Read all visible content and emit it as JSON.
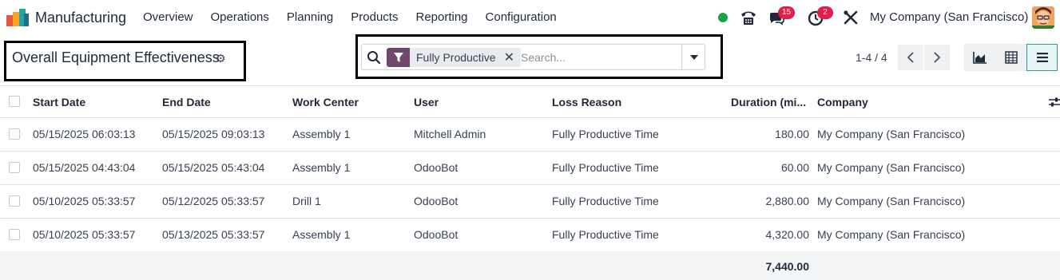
{
  "navbar": {
    "app_name": "Manufacturing",
    "menu": [
      "Overview",
      "Operations",
      "Planning",
      "Products",
      "Reporting",
      "Configuration"
    ],
    "messages_count": "15",
    "activities_count": "2",
    "company": "My Company (San Francisco)"
  },
  "control_panel": {
    "title": "Overall Equipment Effectiveness",
    "search": {
      "facet_label": "Fully Productive",
      "placeholder": "Search..."
    },
    "pager": "1-4 / 4"
  },
  "table": {
    "headers": {
      "start_date": "Start Date",
      "end_date": "End Date",
      "work_center": "Work Center",
      "user": "User",
      "loss_reason": "Loss Reason",
      "duration": "Duration (mi...",
      "company": "Company"
    },
    "rows": [
      {
        "start_date": "05/15/2025 06:03:13",
        "end_date": "05/15/2025 09:03:13",
        "work_center": "Assembly 1",
        "user": "Mitchell Admin",
        "loss_reason": "Fully Productive Time",
        "duration": "180.00",
        "company": "My Company (San Francisco)"
      },
      {
        "start_date": "05/15/2025 04:43:04",
        "end_date": "05/15/2025 05:43:04",
        "work_center": "Assembly 1",
        "user": "OdooBot",
        "loss_reason": "Fully Productive Time",
        "duration": "60.00",
        "company": "My Company (San Francisco)"
      },
      {
        "start_date": "05/10/2025 05:33:57",
        "end_date": "05/12/2025 05:33:57",
        "work_center": "Drill 1",
        "user": "OdooBot",
        "loss_reason": "Fully Productive Time",
        "duration": "2,880.00",
        "company": "My Company (San Francisco)"
      },
      {
        "start_date": "05/10/2025 05:33:57",
        "end_date": "05/13/2025 05:33:57",
        "work_center": "Assembly 1",
        "user": "OdooBot",
        "loss_reason": "Fully Productive Time",
        "duration": "4,320.00",
        "company": "My Company (San Francisco)"
      }
    ],
    "total_duration": "7,440.00"
  },
  "colors": {
    "facet_accent": "#71476e",
    "online": "#16a34a",
    "badge": "#e11d48",
    "active_view": "#35979c"
  }
}
